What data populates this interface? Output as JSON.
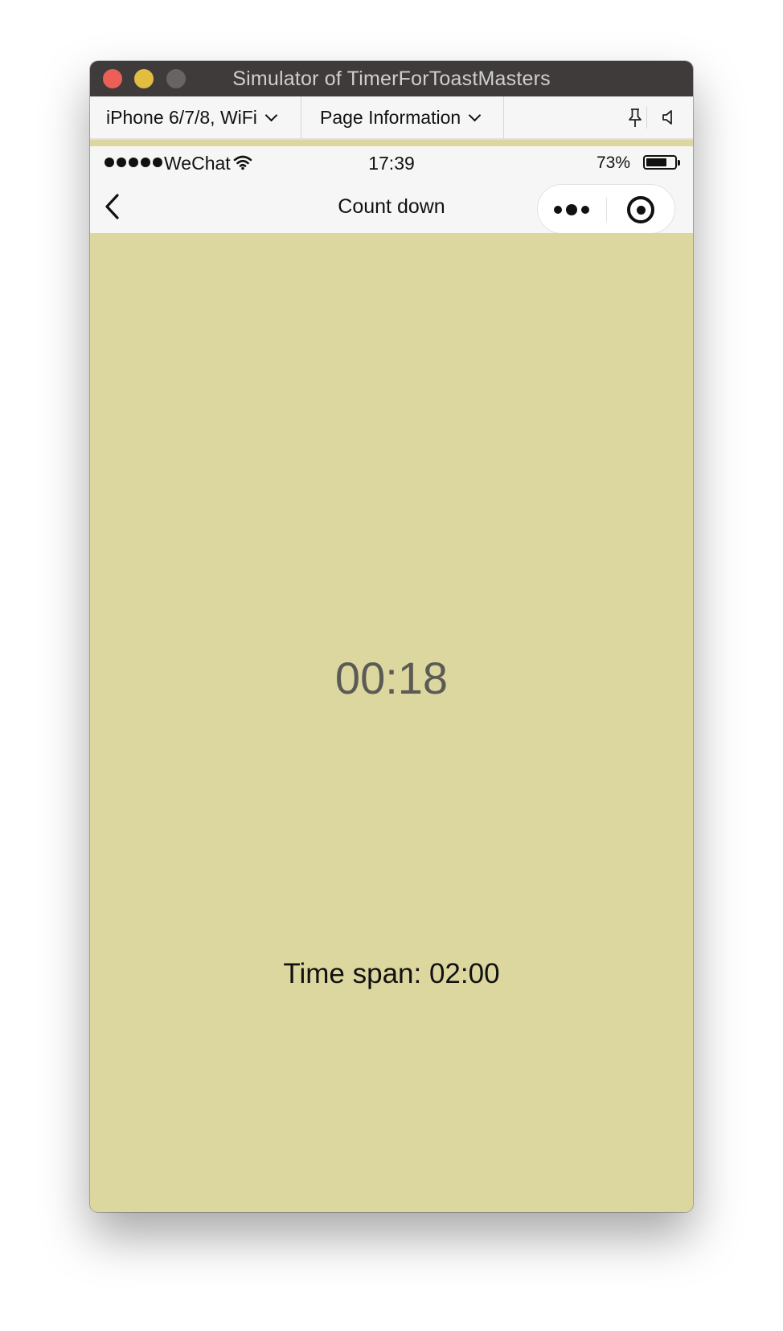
{
  "window": {
    "title": "Simulator of TimerForToastMasters"
  },
  "toolbar": {
    "device_label": "iPhone 6/7/8, WiFi",
    "page_info_label": "Page Information",
    "pin_icon": "pin-icon",
    "sound_icon": "speaker-icon"
  },
  "statusbar": {
    "carrier": "WeChat",
    "time": "17:39",
    "battery_percent": "73%",
    "battery_level": 0.73
  },
  "navbar": {
    "title": "Count down",
    "more_icon": "more-dots-icon",
    "home_icon": "target-circle-icon"
  },
  "timer": {
    "remaining": "00:18",
    "time_span": "Time span: 02:00"
  },
  "colors": {
    "page_background": "#dcd79f",
    "titlebar": "#3f3b3b",
    "close": "#ec5f57",
    "minimize": "#e3bd3f",
    "maximize": "#676464",
    "countdown_text": "#5b5b55"
  }
}
